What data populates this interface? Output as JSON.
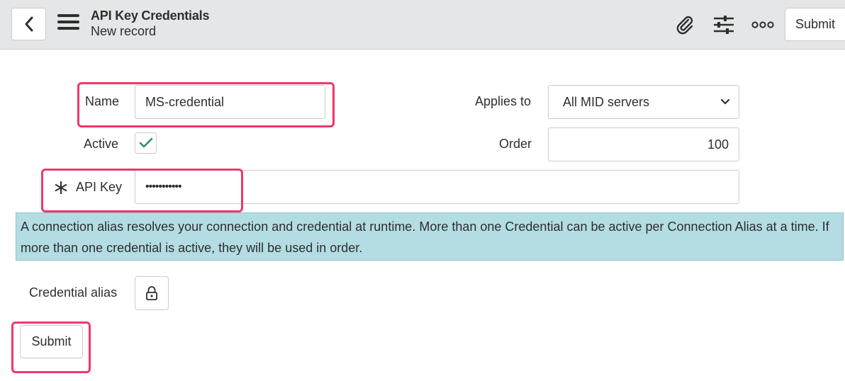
{
  "header": {
    "title": "API Key Credentials",
    "subtitle": "New record",
    "submit_label": "Submit",
    "icons": [
      "back-icon",
      "menu-icon",
      "attachment-icon",
      "settings-sliders-icon",
      "more-options-icon"
    ]
  },
  "form": {
    "name_label": "Name",
    "name_value": "MS-credential",
    "active_label": "Active",
    "active_checked": true,
    "api_key_label": "API Key",
    "api_key_required": true,
    "api_key_value": "•••••••••••",
    "applies_to_label": "Applies to",
    "applies_to_value": "All MID servers",
    "order_label": "Order",
    "order_value": "100",
    "info_text": "A connection alias resolves your connection and credential at runtime. More than one Credential can be active per Connection Alias at a time. If more than one credential is active, they will be used in order.",
    "credential_alias_label": "Credential alias",
    "submit_label": "Submit"
  },
  "colors": {
    "header_bg": "#e4e6e7",
    "info_bg": "#b3dde3",
    "highlight": "#f0386b",
    "check": "#2e8b7a"
  }
}
